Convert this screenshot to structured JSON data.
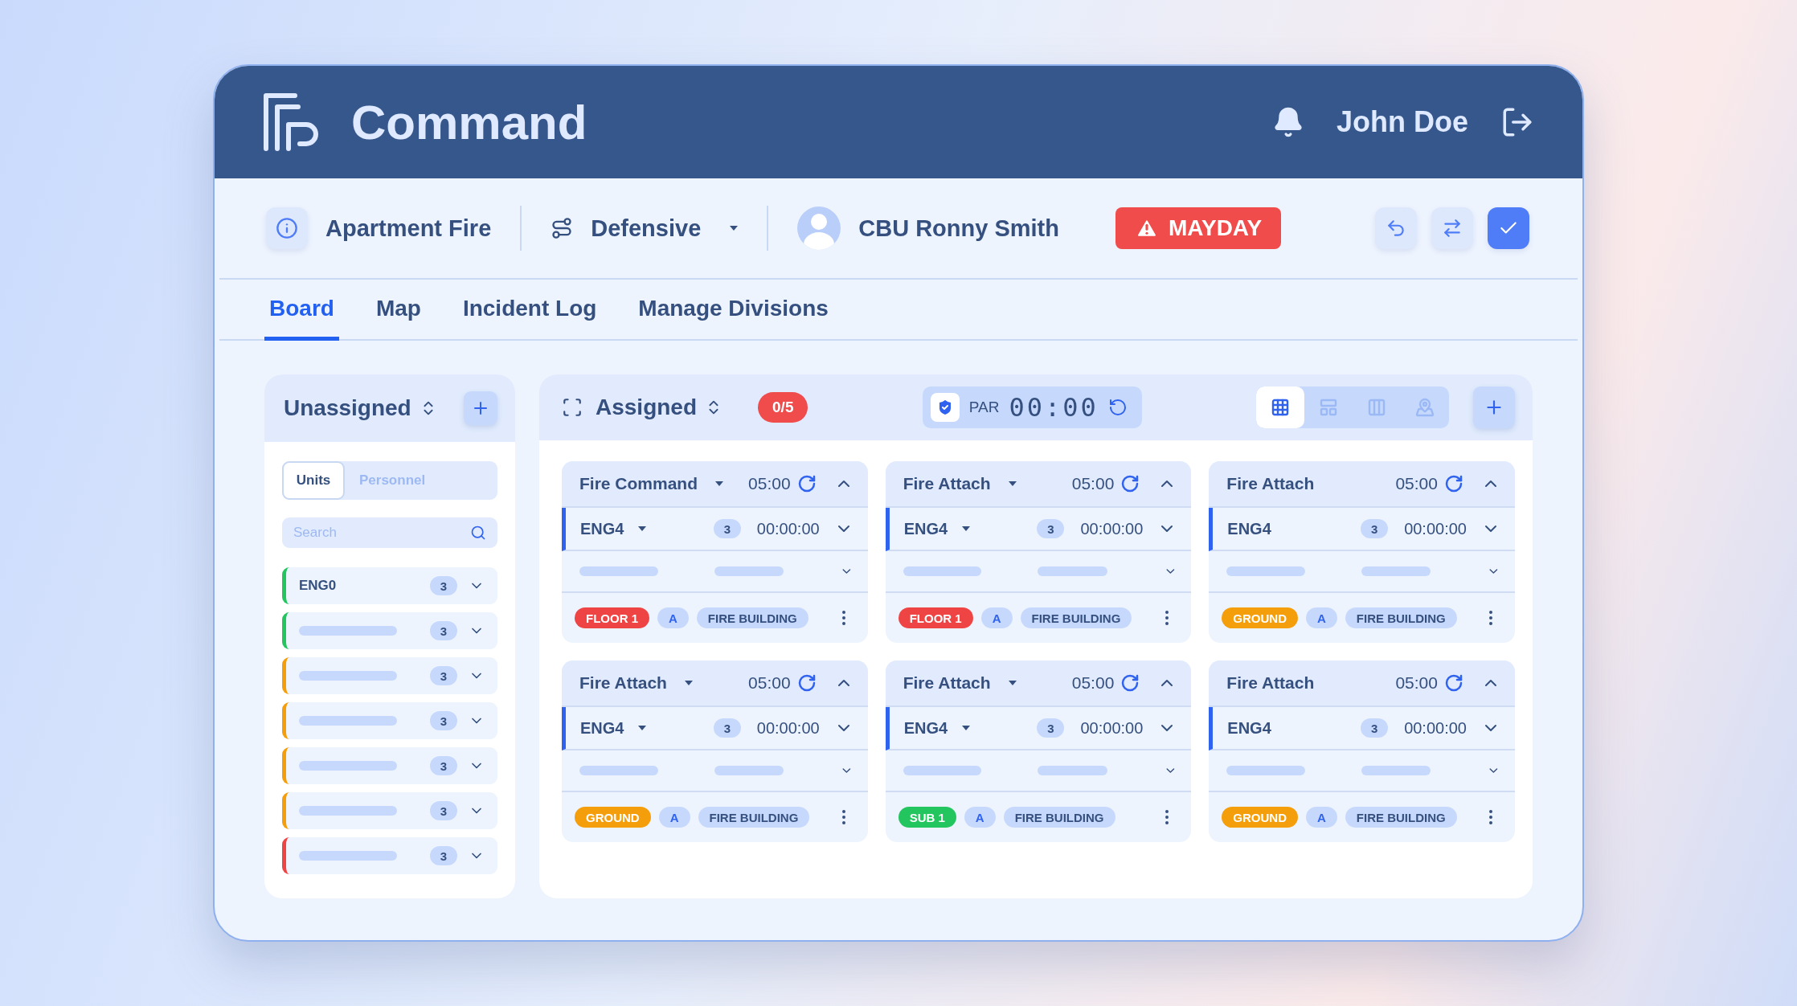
{
  "header": {
    "title": "Command",
    "user": "John Doe"
  },
  "incident": {
    "name": "Apartment Fire",
    "strategy": "Defensive",
    "commander": "CBU Ronny Smith",
    "alert": "MAYDAY"
  },
  "tabs": [
    {
      "label": "Board",
      "selected": true
    },
    {
      "label": "Map",
      "selected": false
    },
    {
      "label": "Incident Log",
      "selected": false
    },
    {
      "label": "Manage Divisions",
      "selected": false
    }
  ],
  "unassigned": {
    "title": "Unassigned",
    "segments": [
      {
        "label": "Units",
        "selected": true
      },
      {
        "label": "Personnel",
        "selected": false
      }
    ],
    "search": {
      "placeholder": "Search"
    },
    "units": [
      {
        "name": "ENG0",
        "count": "3",
        "color": "#22c55e"
      },
      {
        "count": "3",
        "color": "#22c55e"
      },
      {
        "count": "3",
        "color": "#f59e0b"
      },
      {
        "count": "3",
        "color": "#f59e0b"
      },
      {
        "count": "3",
        "color": "#f59e0b"
      },
      {
        "count": "3",
        "color": "#f59e0b"
      },
      {
        "count": "3",
        "color": "#ef4444"
      }
    ]
  },
  "assigned": {
    "title": "Assigned",
    "count": "0/5",
    "par": {
      "label": "PAR",
      "time": "00:00"
    },
    "views": [
      {
        "kind": "grid",
        "selected": true
      },
      {
        "kind": "plan",
        "selected": false
      },
      {
        "kind": "columns",
        "selected": false
      },
      {
        "kind": "map",
        "selected": false
      }
    ],
    "cards": [
      {
        "title": "Fire Command",
        "dropdown": true,
        "timer": "05:00",
        "unit": "ENG4",
        "count": "3",
        "elapsed": "00:00:00",
        "location": {
          "label": "FLOOR 1",
          "color": "#ef4444"
        },
        "crew": "A",
        "area": "FIRE BUILDING"
      },
      {
        "title": "Fire Attach",
        "dropdown": true,
        "timer": "05:00",
        "unit": "ENG4",
        "count": "3",
        "elapsed": "00:00:00",
        "location": {
          "label": "FLOOR 1",
          "color": "#ef4444"
        },
        "crew": "A",
        "area": "FIRE BUILDING"
      },
      {
        "title": "Fire Attach",
        "dropdown": false,
        "timer": "05:00",
        "unit": "ENG4",
        "count": "3",
        "elapsed": "00:00:00",
        "location": {
          "label": "GROUND",
          "color": "#f59e0b"
        },
        "crew": "A",
        "area": "FIRE BUILDING"
      },
      {
        "title": "Fire Attach",
        "dropdown": true,
        "timer": "05:00",
        "unit": "ENG4",
        "count": "3",
        "elapsed": "00:00:00",
        "location": {
          "label": "GROUND",
          "color": "#f59e0b"
        },
        "crew": "A",
        "area": "FIRE BUILDING"
      },
      {
        "title": "Fire Attach",
        "dropdown": true,
        "timer": "05:00",
        "unit": "ENG4",
        "count": "3",
        "elapsed": "00:00:00",
        "location": {
          "label": "SUB 1",
          "color": "#22c55e"
        },
        "crew": "A",
        "area": "FIRE BUILDING"
      },
      {
        "title": "Fire Attach",
        "dropdown": false,
        "timer": "05:00",
        "unit": "ENG4",
        "count": "3",
        "elapsed": "00:00:00",
        "location": {
          "label": "GROUND",
          "color": "#f59e0b"
        },
        "crew": "A",
        "area": "FIRE BUILDING"
      }
    ]
  }
}
